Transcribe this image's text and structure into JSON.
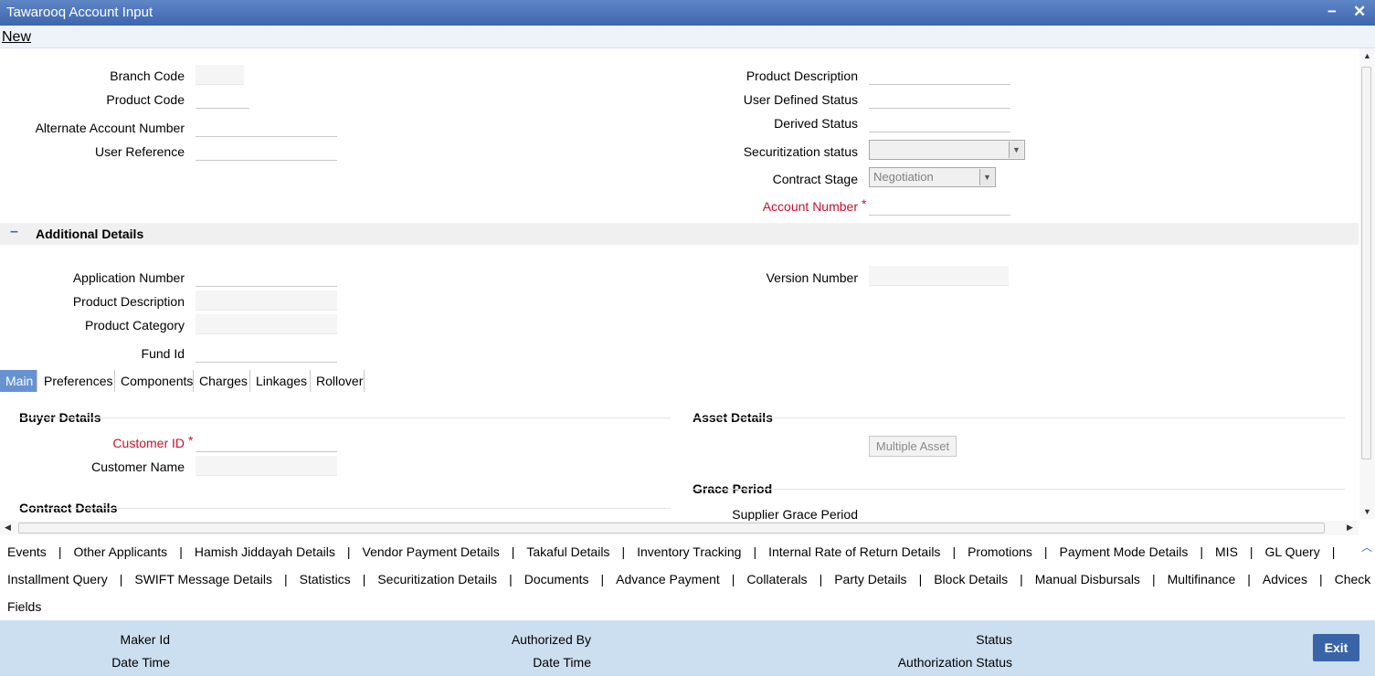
{
  "window": {
    "title": "Tawarooq Account Input",
    "minimize_glyph": "−",
    "close_glyph": "✕"
  },
  "menu": {
    "new_label": "New"
  },
  "header_left": {
    "branch_code": {
      "label": "Branch Code",
      "value": ""
    },
    "product_code": {
      "label": "Product Code",
      "value": ""
    },
    "alternate_account_number": {
      "label": "Alternate Account Number",
      "value": ""
    },
    "user_reference": {
      "label": "User Reference",
      "value": ""
    }
  },
  "header_right": {
    "product_description": {
      "label": "Product Description",
      "value": ""
    },
    "user_defined_status": {
      "label": "User Defined Status",
      "value": ""
    },
    "derived_status": {
      "label": "Derived Status",
      "value": ""
    },
    "securitization_status": {
      "label": "Securitization status",
      "value": ""
    },
    "contract_stage": {
      "label": "Contract Stage",
      "value": "Negotiation"
    },
    "account_number": {
      "label": "Account Number",
      "required_mark": "*",
      "value": ""
    }
  },
  "additional_details": {
    "title": "Additional Details",
    "toggle_glyph": "–",
    "application_number": {
      "label": "Application Number",
      "value": ""
    },
    "product_description": {
      "label": "Product Description",
      "value": ""
    },
    "product_category": {
      "label": "Product Category",
      "value": ""
    },
    "fund_id": {
      "label": "Fund Id",
      "value": ""
    },
    "version_number": {
      "label": "Version Number",
      "value": ""
    }
  },
  "tabs": [
    "Main",
    "Preferences",
    "Components",
    "Charges",
    "Linkages",
    "Rollover"
  ],
  "active_tab": "Main",
  "main": {
    "buyer_details": {
      "title": "Buyer Details",
      "customer_id": {
        "label": "Customer ID",
        "required_mark": "*",
        "value": ""
      },
      "customer_name": {
        "label": "Customer Name",
        "value": ""
      }
    },
    "contract_details": {
      "title": "Contract Details"
    },
    "asset_details": {
      "title": "Asset Details",
      "multiple_asset_button": "Multiple Asset"
    },
    "grace_period": {
      "title": "Grace Period",
      "supplier_grace_period": {
        "label": "Supplier Grace Period"
      }
    }
  },
  "links": {
    "row1": [
      "Events",
      "Other Applicants",
      "Hamish Jiddayah Details",
      "Vendor Payment Details",
      "Takaful Details",
      "Inventory Tracking",
      "Internal Rate of Return Details",
      "Promotions",
      "Payment Mode Details",
      "MIS",
      "GL Query"
    ],
    "row2": [
      "Installment Query",
      "SWIFT Message Details",
      "Statistics",
      "Securitization Details",
      "Documents",
      "Advance Payment",
      "Collaterals",
      "Party Details",
      "Block Details",
      "Manual Disbursals",
      "Multifinance",
      "Advices",
      "Check List"
    ],
    "row3": [
      "Fields"
    ],
    "separator": "|"
  },
  "footer": {
    "maker_id": "Maker Id",
    "maker_date_time": "Date Time",
    "authorized_by": "Authorized By",
    "auth_date_time": "Date Time",
    "status": "Status",
    "authorization_status": "Authorization Status",
    "exit_label": "Exit"
  }
}
